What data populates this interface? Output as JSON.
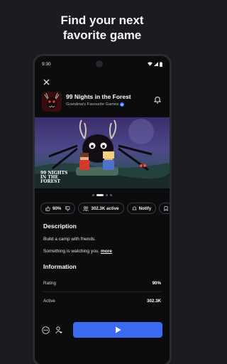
{
  "headline": {
    "line1": "Find your next",
    "line2": "favorite game"
  },
  "status_bar": {
    "time": "9:30"
  },
  "game": {
    "title": "99 Nights in the Forest",
    "creator": "Grandma's Favourite Games",
    "banner_logo_text": "99 NIGHTS IN THE FOREST"
  },
  "carousel": {
    "count": 4,
    "active_index": 1
  },
  "chips": {
    "rating": "90%",
    "active": "302.3K active",
    "notify": "Notify"
  },
  "description": {
    "heading": "Description",
    "line1": "Build a camp with friends.",
    "line2": "Something is watching you.",
    "more": "more"
  },
  "information": {
    "heading": "Information",
    "rows": [
      {
        "label": "Rating",
        "value": "90%"
      },
      {
        "label": "Active",
        "value": "302.3K"
      }
    ]
  },
  "colors": {
    "accent": "#3b6bf3",
    "background": "#0b0c0e",
    "verified": "#4a7cff"
  },
  "icons": [
    "close-icon",
    "bell-icon",
    "thumbs-up-icon",
    "thumbs-down-icon",
    "people-icon",
    "bookmark-icon",
    "more-icon",
    "add-friend-icon",
    "play-icon",
    "verified-icon"
  ]
}
